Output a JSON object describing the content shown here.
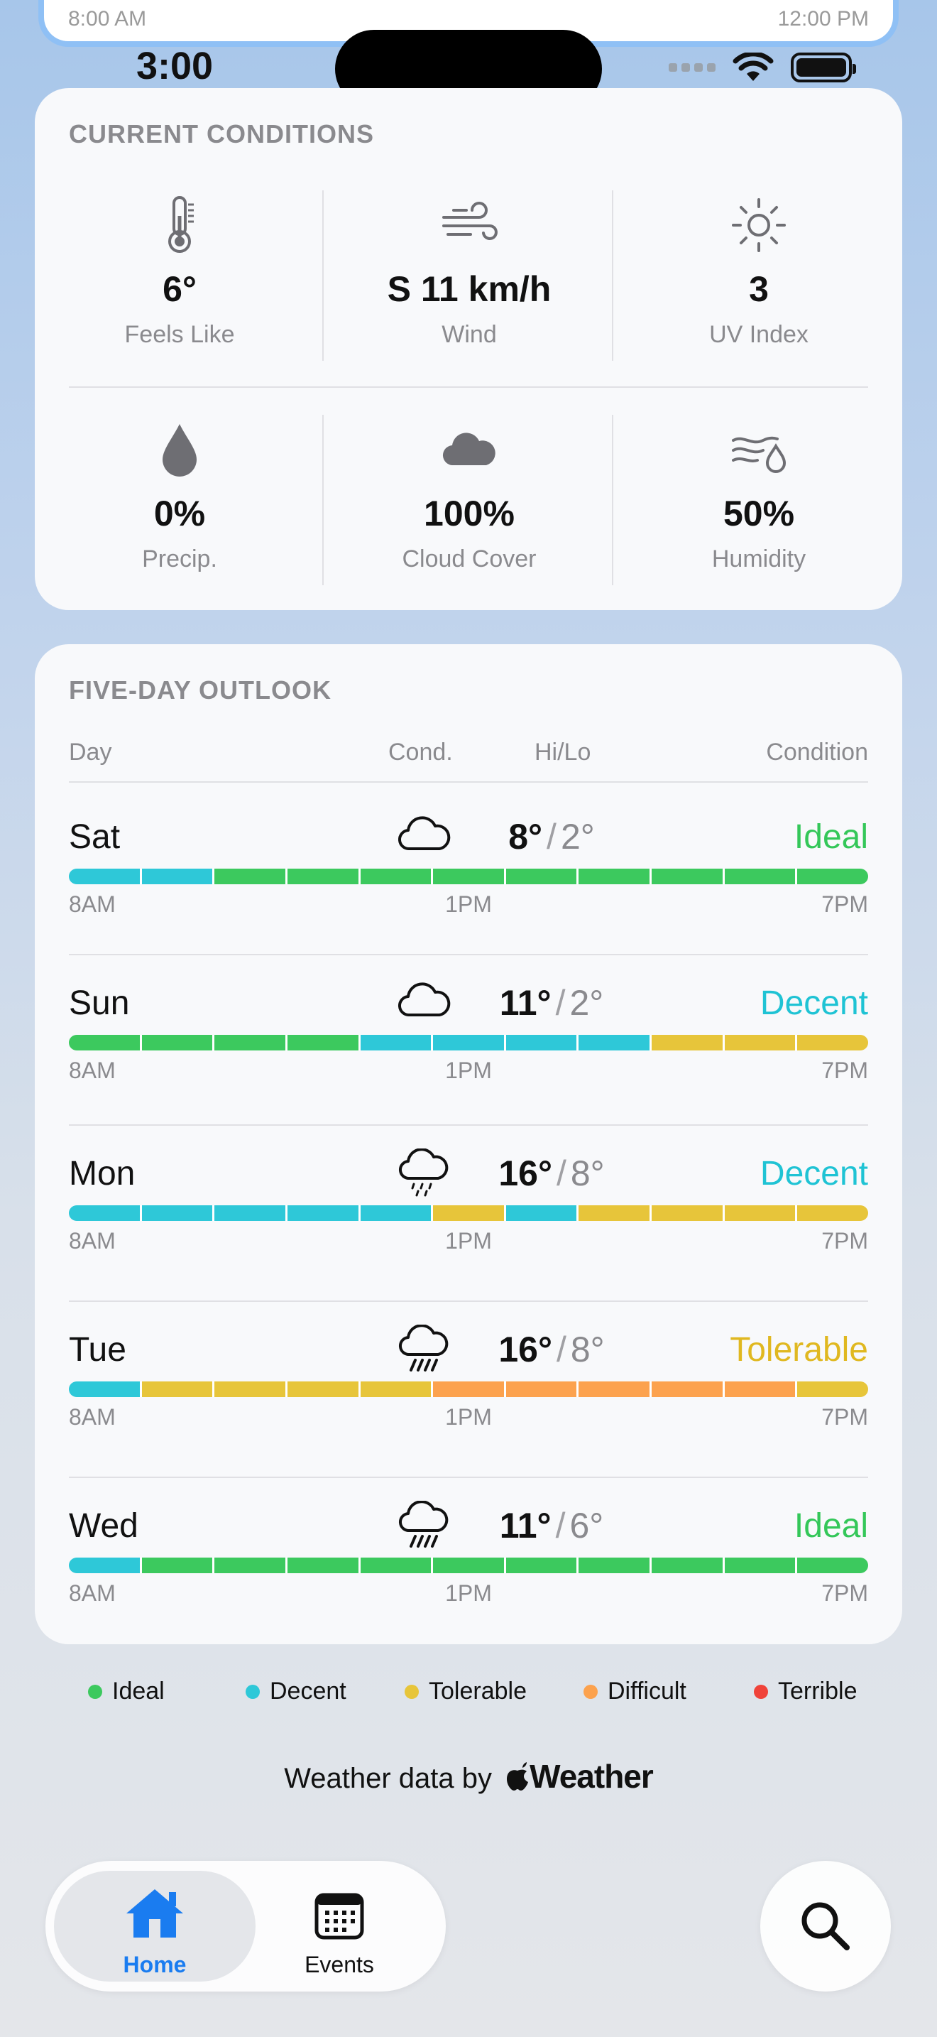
{
  "top_card": {
    "left_time": "8:00 AM",
    "right_time": "12:00 PM"
  },
  "status_bar": {
    "time": "3:00"
  },
  "current_conditions": {
    "title": "CURRENT CONDITIONS",
    "feels_like": {
      "value": "6°",
      "label": "Feels Like",
      "icon": "thermometer-icon"
    },
    "wind": {
      "value": "S 11 km/h",
      "label": "Wind",
      "icon": "wind-icon"
    },
    "uv": {
      "value": "3",
      "label": "UV Index",
      "icon": "sun-icon"
    },
    "precip": {
      "value": "0%",
      "label": "Precip.",
      "icon": "raindrop-icon"
    },
    "cloud": {
      "value": "100%",
      "label": "Cloud Cover",
      "icon": "cloud-icon"
    },
    "humidity": {
      "value": "50%",
      "label": "Humidity",
      "icon": "humidity-icon"
    }
  },
  "outlook": {
    "title": "FIVE-DAY OUTLOOK",
    "headers": {
      "day": "Day",
      "cond": "Cond.",
      "hilo": "Hi/Lo",
      "condition": "Condition"
    },
    "ticks": {
      "start": "8AM",
      "mid": "1PM",
      "end": "7PM"
    },
    "days": [
      {
        "name": "Sat",
        "icon": "cloud-icon",
        "hi": "8°",
        "lo": "2°",
        "sep": "/",
        "rating": "Ideal",
        "rating_color": "#34c759",
        "hours": [
          "D",
          "D",
          "I",
          "I",
          "I",
          "I",
          "I",
          "I",
          "I",
          "I",
          "I"
        ]
      },
      {
        "name": "Sun",
        "icon": "cloud-icon",
        "hi": "11°",
        "lo": "2°",
        "sep": "/",
        "rating": "Decent",
        "rating_color": "#1fc3d4",
        "hours": [
          "I",
          "I",
          "I",
          "I",
          "D",
          "D",
          "D",
          "D",
          "T",
          "T",
          "T"
        ]
      },
      {
        "name": "Mon",
        "icon": "drizzle-icon",
        "hi": "16°",
        "lo": "8°",
        "sep": "/",
        "rating": "Decent",
        "rating_color": "#1fc3d4",
        "hours": [
          "D",
          "D",
          "D",
          "D",
          "D",
          "T",
          "D",
          "T",
          "T",
          "T",
          "T"
        ]
      },
      {
        "name": "Tue",
        "icon": "rain-icon",
        "hi": "16°",
        "lo": "8°",
        "sep": "/",
        "rating": "Tolerable",
        "rating_color": "#e0b820",
        "hours": [
          "D",
          "T",
          "T",
          "T",
          "T",
          "F",
          "F",
          "F",
          "F",
          "F",
          "T"
        ]
      },
      {
        "name": "Wed",
        "icon": "rain-icon",
        "hi": "11°",
        "lo": "6°",
        "sep": "/",
        "rating": "Ideal",
        "rating_color": "#34c759",
        "hours": [
          "D",
          "I",
          "I",
          "I",
          "I",
          "I",
          "I",
          "I",
          "I",
          "I",
          "I"
        ]
      }
    ]
  },
  "legend": [
    {
      "label": "Ideal",
      "color": "#3cc95e",
      "code": "I"
    },
    {
      "label": "Decent",
      "color": "#2ec8d8",
      "code": "D"
    },
    {
      "label": "Tolerable",
      "color": "#e7c53a",
      "code": "T"
    },
    {
      "label": "Difficult",
      "color": "#fca24e",
      "code": "F"
    },
    {
      "label": "Terrible",
      "color": "#f0433a",
      "code": "X"
    }
  ],
  "attribution": {
    "prefix": "Weather data by",
    "brand": "Weather"
  },
  "tabbar": {
    "home": "Home",
    "events": "Events"
  },
  "colors": {
    "accent": "#1a7cf0",
    "card": "#f8f9fb"
  }
}
